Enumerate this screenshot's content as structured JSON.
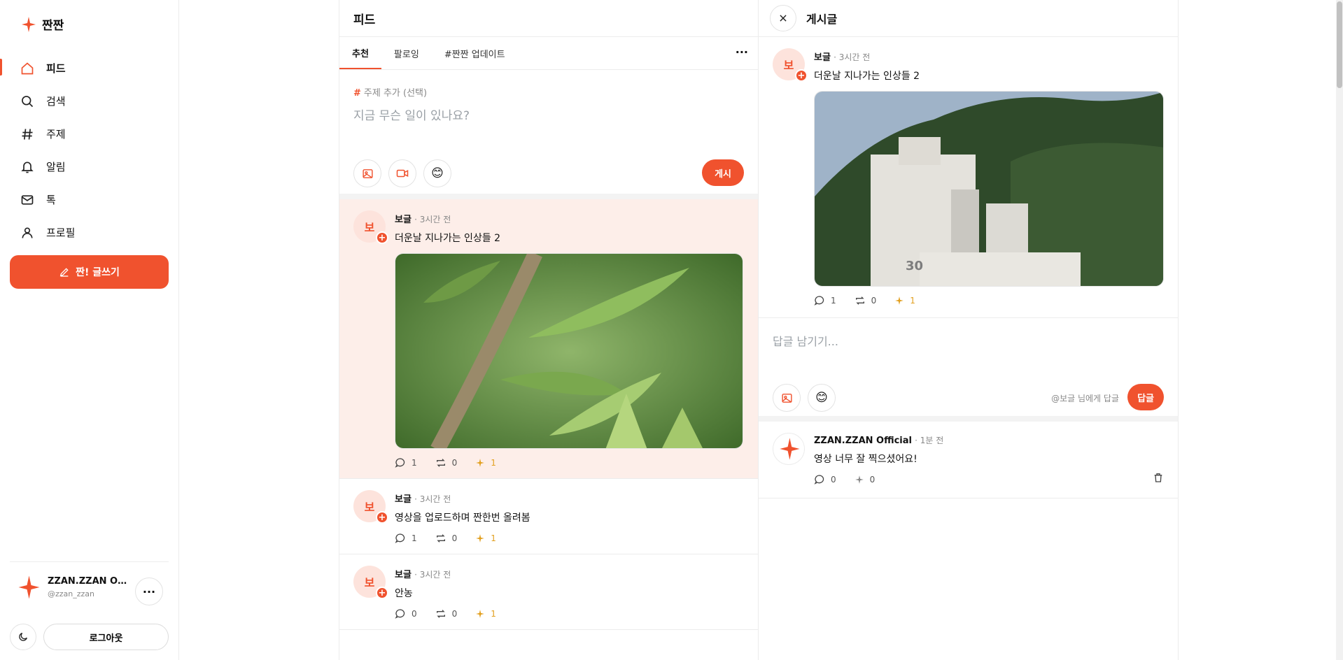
{
  "app": {
    "name": "짠짠",
    "accent": "#f0522e"
  },
  "sidebar": {
    "items": [
      {
        "label": "피드",
        "icon": "home-icon",
        "active": true
      },
      {
        "label": "검색",
        "icon": "search-icon"
      },
      {
        "label": "주제",
        "icon": "hash-icon"
      },
      {
        "label": "알림",
        "icon": "bell-icon"
      },
      {
        "label": "톡",
        "icon": "mail-icon"
      },
      {
        "label": "프로필",
        "icon": "user-icon"
      }
    ],
    "write_label": "짠! 글쓰기",
    "profile": {
      "name": "ZZAN.ZZAN Official",
      "handle": "@zzan_zzan"
    },
    "logout_label": "로그아웃"
  },
  "feed": {
    "title": "피드",
    "tabs": [
      "추천",
      "팔로잉",
      "#짠짠 업데이트"
    ],
    "composer": {
      "topic_label": "주제 추가 (선택)",
      "placeholder": "지금 무슨 일이 있나요?",
      "post_label": "게시"
    },
    "posts": [
      {
        "avatar": "보",
        "author": "보글",
        "time": "· 3시간 전",
        "text": "더운날 지나가는 인상들 2",
        "comments": "1",
        "reposts": "0",
        "sparks": "1"
      },
      {
        "avatar": "보",
        "author": "보글",
        "time": "· 3시간 전",
        "text": "영상을 업로드하며 짠한번 올려봄",
        "comments": "1",
        "reposts": "0",
        "sparks": "1"
      },
      {
        "avatar": "보",
        "author": "보글",
        "time": "· 3시간 전",
        "text": "안농",
        "comments": "0",
        "reposts": "0",
        "sparks": "1"
      }
    ]
  },
  "detail": {
    "title": "게시글",
    "post": {
      "avatar": "보",
      "author": "보글",
      "time": "· 3시간 전",
      "text": "더운날 지나가는 인상들 2",
      "comments": "1",
      "reposts": "0",
      "sparks": "1"
    },
    "reply": {
      "placeholder": "답글 남기기...",
      "to_label": "@보글 님에게 답글",
      "button_label": "답글"
    },
    "comments": [
      {
        "author": "ZZAN.ZZAN Official",
        "time": "· 1분 전",
        "text": "영상 너무 잘 찍으셨어요!",
        "comments": "0",
        "sparks": "0"
      }
    ]
  }
}
